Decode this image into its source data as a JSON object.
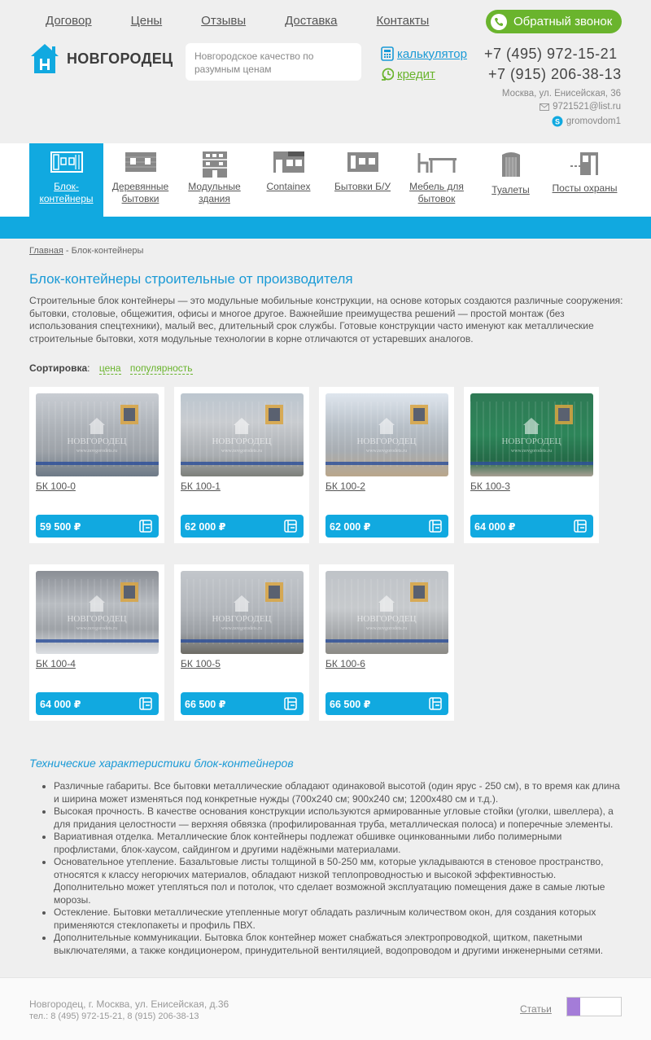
{
  "nav": [
    "Договор",
    "Цены",
    "Отзывы",
    "Доставка",
    "Контакты"
  ],
  "callback": "Обратный звонок",
  "logo": "НОВГОРОДЕЦ",
  "slogan": "Новгородское качество по разумным ценам",
  "calc": "калькулятор",
  "credit": "кредит",
  "phone1": "+7 (495) 972-15-21",
  "phone2": "+7 (915) 206-38-13",
  "address": "Москва, ул. Енисейская, 36",
  "email": "9721521@list.ru",
  "skype": "gromovdom1",
  "categories": [
    "Блок-\nконтейнеры",
    "Деревянные\nбытовки",
    "Модульные\nздания",
    "Containex",
    "Бытовки Б/У",
    "Мебель для\nбытовок",
    "Туалеты",
    "Посты охраны"
  ],
  "breadcrumb": {
    "home": "Главная",
    "sep": " - ",
    "current": "Блок-контейнеры"
  },
  "title": "Блок-контейнеры строительные от производителя",
  "intro": "Строительные блок контейнеры — это модульные мобильные конструкции, на основе которых создаются различные сооружения: бытовки, столовые, общежития, офисы и многое другое. Важнейшие преимущества решений — простой монтаж (без использования спецтехники), малый вес, длительный срок службы. Готовые конструкции часто именуют как металлические строительные бытовки, хотя модульные технологии в корне отличаются от устаревших аналогов.",
  "sort": {
    "label": "Сортировка",
    "colon": ":",
    "price": "цена",
    "pop": "популярность"
  },
  "products": [
    {
      "name": "БК 100-0",
      "price": "59 500 ₽"
    },
    {
      "name": "БК 100-1",
      "price": "62 000 ₽"
    },
    {
      "name": "БК 100-2",
      "price": "62 000 ₽"
    },
    {
      "name": "БК 100-3",
      "price": "64 000 ₽"
    },
    {
      "name": "БК 100-4",
      "price": "64 000 ₽"
    },
    {
      "name": "БК 100-5",
      "price": "66 500 ₽"
    },
    {
      "name": "БК 100-6",
      "price": "66 500 ₽"
    }
  ],
  "watermark": "НОВГОРОДЕЦ",
  "watermark_url": "www.novgorodets.ru",
  "tech_title": "Технические характеристики блок-контейнеров",
  "features": [
    "Различные габариты. Все бытовки металлические обладают одинаковой высотой (один ярус - 250 см), в то время как длина и ширина может изменяться под конкретные нужды (700х240 см; 900х240 см; 1200х480 см и т.д.).",
    "Высокая прочность. В качестве основания конструкции используются армированные угловые стойки (уголки, швеллера), а для придания целостности — верхняя обвязка (профилированная труба, металлическая полоса) и поперечные элементы.",
    "Вариативная отделка. Металлические блок контейнеры подлежат обшивке оцинкованными либо полимерными профлистами, блок-хаусом, сайдингом и другими надёжными материалами.",
    "Основательное утепление. Базальтовые листы толщиной в 50-250 мм, которые укладываются в стеновое пространство, относятся к классу негорючих материалов, обладают низкой теплопроводностью и высокой эффективностью. Дополнительно может утепляться пол и потолок, что сделает возможной эксплуатацию помещения даже в самые лютые морозы.",
    "Остекление. Бытовки металлические утепленные могут обладать различным количеством окон, для создания которых применяются стеклопакеты и профиль ПВХ.",
    "Дополнительные коммуникации. Бытовка блок контейнер может снабжаться электропроводкой, щитком, пакетными выключателями, а также кондиционером, принудительной вентиляцией, водопроводом и другими инженерными сетями."
  ],
  "footer": {
    "line1": "Новгородец, г. Москва, ул. Енисейская, д.36",
    "line2": "тел.: 8 (495) 972-15-21, 8 (915) 206-38-13",
    "articles": "Статьи"
  },
  "colors": {
    "blue": "#11a9e0",
    "green": "#6ab42d"
  }
}
